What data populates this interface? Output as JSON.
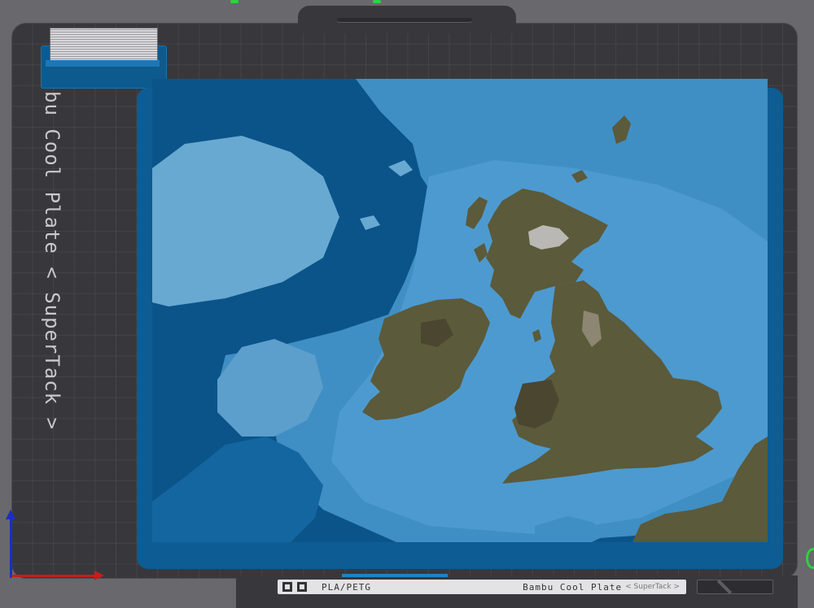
{
  "plate": {
    "label": "bu Cool Plate < SuperTack >",
    "bottom_sticker": {
      "filament": "PLA/PETG",
      "plate_name": "Bambu Cool Plate",
      "plate_variant": "< SuperTack >"
    }
  },
  "colors": {
    "plate": "#38383c",
    "background": "#68686d",
    "ocean_deep": "#0b5489",
    "ocean": "#1a78b9",
    "shelf": "#3f8fc4",
    "shelf_light": "#68a9d2",
    "land": "#5b5a3a",
    "land_dark": "#4a4630",
    "mountain": "#b9b8b4",
    "axis_x": "#c81c1c",
    "axis_y": "#1a2ec4",
    "accent": "#2fd23f"
  },
  "icons": {
    "axis": "xyz-axis-icon",
    "sticker": "qr-code-icon"
  }
}
